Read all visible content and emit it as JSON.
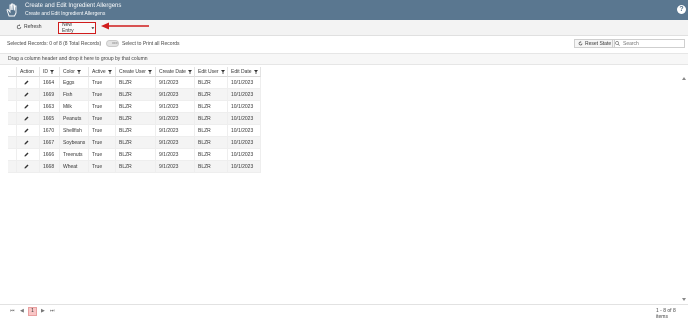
{
  "header": {
    "title": "Create and Edit Ingredient Allergens",
    "subtitle": "Create and Edit Ingredient Allergens",
    "help_label": "?"
  },
  "toolbar": {
    "refresh_label": "Refresh",
    "new_entry_label": "New Entry"
  },
  "info": {
    "selected_records": "Selected Records: 0 of 8 (8 Total Records)",
    "toggle_state": "OFF",
    "toggle_label": "Select to Print all Records",
    "reset_label": "Reset State",
    "search_placeholder": "Search"
  },
  "group_hint": "Drag a column header and drop it here to group by that column",
  "table": {
    "columns": [
      "Action",
      "ID",
      "Color",
      "Active",
      "Create User",
      "Create Date",
      "Edit User",
      "Edit Date"
    ],
    "rows": [
      [
        "",
        "1664",
        "Eggs",
        "True",
        "BLZR",
        "9/1/2023",
        "BLZR",
        "10/1/2023"
      ],
      [
        "",
        "1669",
        "Fish",
        "True",
        "BLZR",
        "9/1/2023",
        "BLZR",
        "10/1/2023"
      ],
      [
        "",
        "1663",
        "Milk",
        "True",
        "BLZR",
        "9/1/2023",
        "BLZR",
        "10/1/2023"
      ],
      [
        "",
        "1665",
        "Peanuts",
        "True",
        "BLZR",
        "9/1/2023",
        "BLZR",
        "10/1/2023"
      ],
      [
        "",
        "1670",
        "Shellfish",
        "True",
        "BLZR",
        "9/1/2023",
        "BLZR",
        "10/1/2023"
      ],
      [
        "",
        "1667",
        "Soybeans",
        "True",
        "BLZR",
        "9/1/2023",
        "BLZR",
        "10/1/2023"
      ],
      [
        "",
        "1666",
        "Treenuts",
        "True",
        "BLZR",
        "9/1/2023",
        "BLZR",
        "10/1/2023"
      ],
      [
        "",
        "1668",
        "Wheat",
        "True",
        "BLZR",
        "9/1/2023",
        "BLZR",
        "10/1/2023"
      ]
    ]
  },
  "pagination": {
    "current_page": "1",
    "items_label": "1 - 8 of 8 items"
  },
  "colors": {
    "header_bg": "#5a7790",
    "highlight_red": "#d01c1c",
    "active_page": "#f9c6c6"
  },
  "icons": {
    "app": "hand-icon",
    "refresh": "refresh-icon",
    "dropdown": "caret-down-icon",
    "edit": "pencil-icon",
    "filter": "filter-icon",
    "search": "search-icon",
    "help": "help-icon"
  }
}
